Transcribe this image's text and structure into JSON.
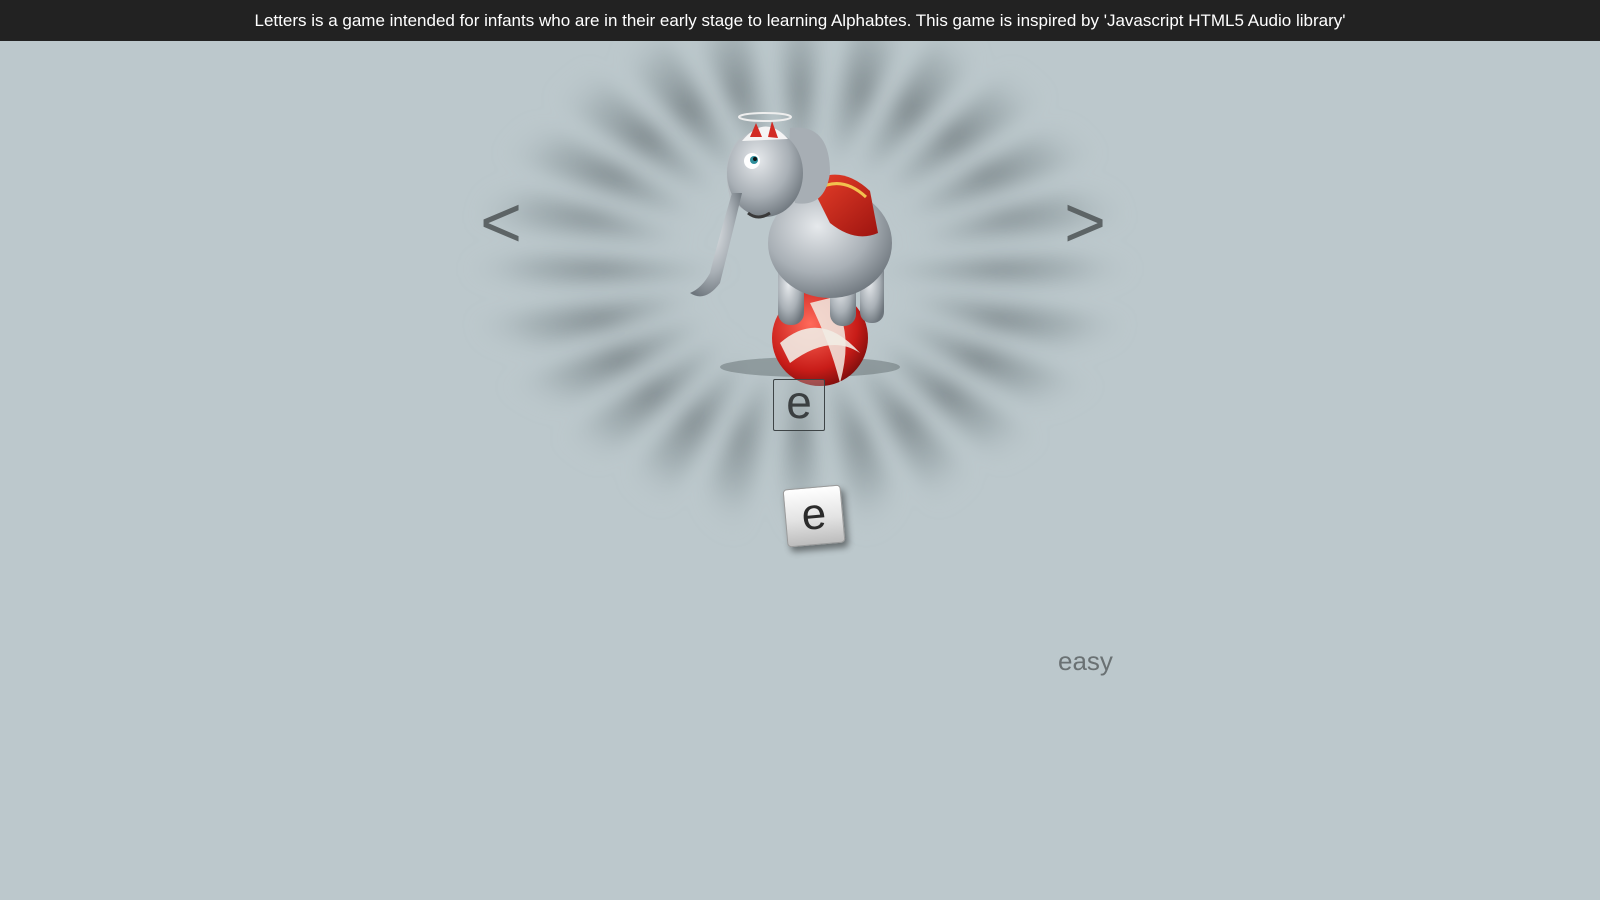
{
  "header": {
    "description": "Letters is a game intended for infants who are in their early stage to learning Alphabtes. This game is inspired by 'Javascript HTML5 Audio library'"
  },
  "navigation": {
    "prev_label": "<",
    "next_label": ">"
  },
  "game": {
    "picture_icon": "elephant-on-ball-icon",
    "target_letter": "e",
    "tile_letter": "e",
    "difficulty": "easy"
  },
  "colors": {
    "background": "#bcc8cc",
    "header_bg": "#222222",
    "header_text": "#ffffff",
    "nav_arrow": "#5d6466"
  }
}
